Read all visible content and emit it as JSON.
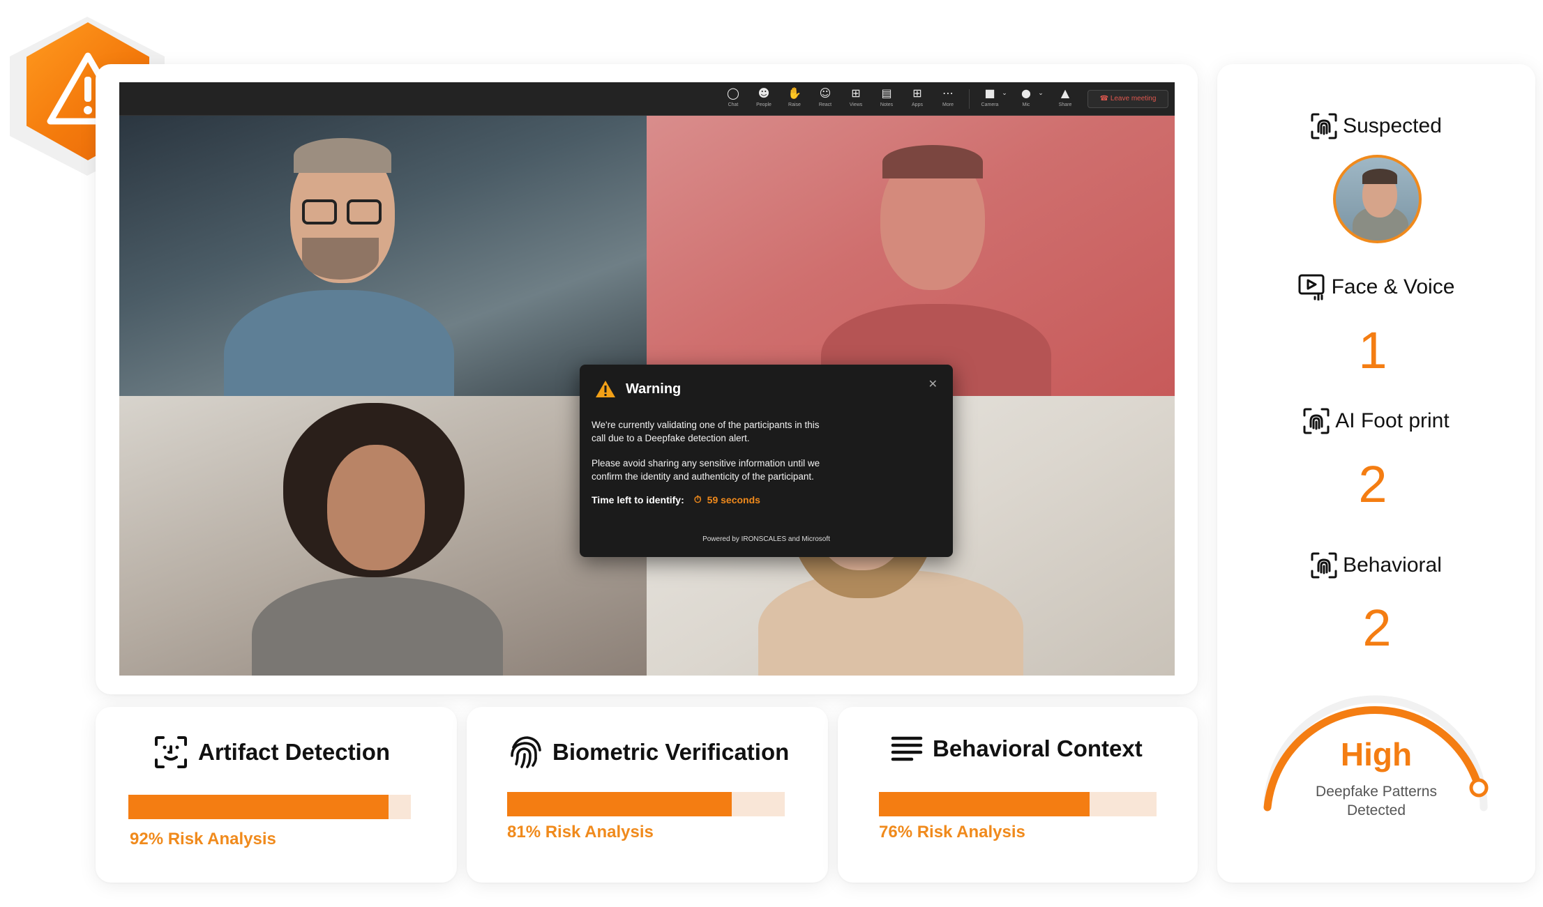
{
  "toolbar": {
    "items": [
      {
        "label": "Chat",
        "icon": "chat-icon"
      },
      {
        "label": "People",
        "icon": "people-icon"
      },
      {
        "label": "Raise",
        "icon": "raise-hand-icon"
      },
      {
        "label": "React",
        "icon": "react-icon"
      },
      {
        "label": "Views",
        "icon": "views-icon"
      },
      {
        "label": "Notes",
        "icon": "notes-icon"
      },
      {
        "label": "Apps",
        "icon": "apps-icon"
      },
      {
        "label": "More",
        "icon": "more-icon"
      },
      {
        "label": "Camera",
        "icon": "camera-icon"
      },
      {
        "label": "Mic",
        "icon": "mic-icon"
      },
      {
        "label": "Share",
        "icon": "share-icon"
      }
    ],
    "leave_label": "Leave meeting"
  },
  "warning": {
    "title": "Warning",
    "paragraph1_line1": "We're currently validating one of the participants in this",
    "paragraph1_line2": "call due to a Deepfake detection alert.",
    "paragraph2_line1": "Please avoid sharing any sensitive information until we",
    "paragraph2_line2": "confirm the identity and authenticity of the participant.",
    "timer_label": "Time left to identify:",
    "timer_value": "59 seconds",
    "powered_by": "Powered by IRONSCALES and Microsoft"
  },
  "metrics": [
    {
      "title": "Artifact Detection",
      "icon": "face-scan-icon",
      "risk": 0.92,
      "risk_label": "92% Risk Analysis"
    },
    {
      "title": "Biometric Verification",
      "icon": "fingerprint-icon",
      "risk": 0.81,
      "risk_label": "81% Risk Analysis"
    },
    {
      "title": "Behavioral Context",
      "icon": "lines-icon",
      "risk": 0.76,
      "risk_label": "76% Risk Analysis"
    }
  ],
  "panel": {
    "suspected_label": "Suspected",
    "face_voice_label": "Face & Voice",
    "face_voice_count": "1",
    "ai_footprint_label": "AI Foot print",
    "ai_footprint_count": "2",
    "behavioral_label": "Behavioral",
    "behavioral_count": "2",
    "level": "High",
    "level_caption_line1": "Deepfake Patterns",
    "level_caption_line2": "Detected"
  },
  "colors": {
    "accent": "#f47d12",
    "accent_light": "#f9e6d7",
    "meeting_bg": "#1e1e1e"
  }
}
